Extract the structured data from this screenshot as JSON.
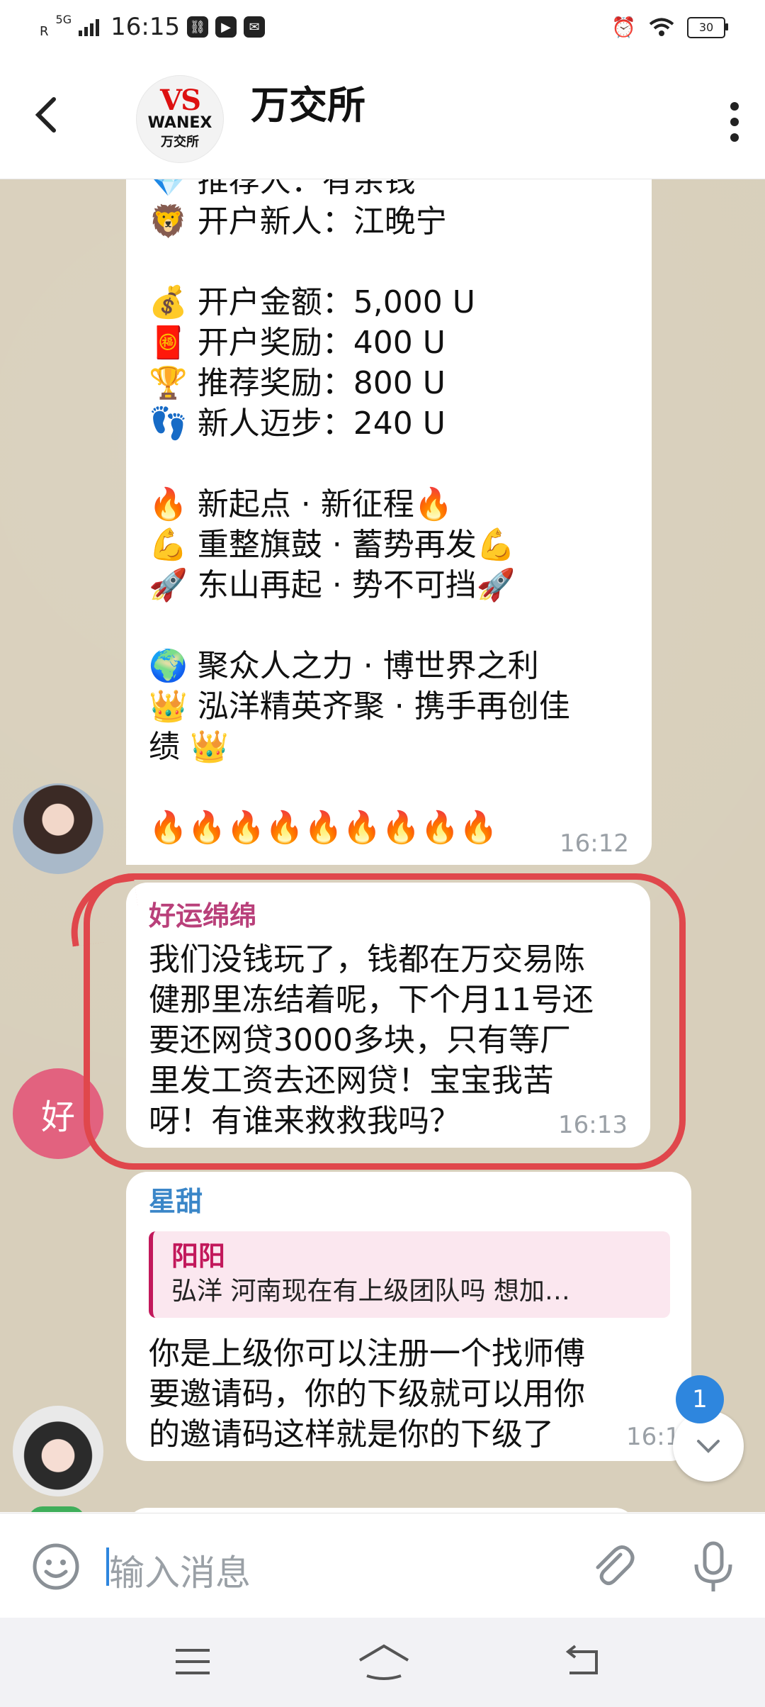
{
  "status_bar": {
    "network_label": "R",
    "network_type": "5G",
    "time": "16:15",
    "battery_level": "30"
  },
  "header": {
    "title": "万交所",
    "logo_mark": "VS",
    "logo_en": "WANEX",
    "logo_cn": "万交所"
  },
  "messages": [
    {
      "type": "announcement",
      "lines": [
        {
          "emoji": "💎",
          "text": "推荐人：有余钱"
        },
        {
          "emoji": "🦁",
          "text": "开户新人：江晚宁"
        },
        {
          "emoji": "",
          "text": ""
        },
        {
          "emoji": "💰",
          "text": "开户金额：5,000 U"
        },
        {
          "emoji": "🧧",
          "text": "开户奖励：400 U"
        },
        {
          "emoji": "🏆",
          "text": "推荐奖励：800 U"
        },
        {
          "emoji": "👣",
          "text": "新人迈步：240 U"
        },
        {
          "emoji": "",
          "text": ""
        },
        {
          "emoji": "🔥",
          "text": "新起点 · 新征程🔥"
        },
        {
          "emoji": "💪",
          "text": "重整旗鼓 · 蓄势再发💪"
        },
        {
          "emoji": "🚀",
          "text": "东山再起 · 势不可挡🚀"
        },
        {
          "emoji": "",
          "text": ""
        },
        {
          "emoji": "🌍",
          "text": "聚众人之力 · 博世界之利"
        },
        {
          "emoji": "👑",
          "text": "泓洋精英齐聚 · 携手再创佳"
        },
        {
          "emoji": "",
          "text": "绩 👑"
        },
        {
          "emoji": "",
          "text": ""
        },
        {
          "emoji": "",
          "text": "🔥🔥🔥🔥🔥🔥🔥🔥🔥"
        }
      ],
      "time": "16:12"
    },
    {
      "type": "text",
      "sender": "好运绵绵",
      "sender_color": "#b9407a",
      "avatar_letter": "好",
      "lines": [
        "我们没钱玩了，钱都在万交易陈",
        "健那里冻结着呢，下个月11号还",
        "要还网贷3000多块，只有等厂",
        "里发工资去还网贷！宝宝我苦",
        "呀！有谁来救救我吗？"
      ],
      "time": "16:13"
    },
    {
      "type": "reply",
      "sender": "星甜",
      "sender_color": "#3a86c8",
      "quote_name": "阳阳",
      "quote_text": "弘洋  河南现在有上级团队吗  想加…",
      "lines": [
        "你是上级你可以注册一个找师傅",
        "要邀请码，你的下级就可以用你",
        "的邀请码这样就是你的下级了"
      ],
      "time": "16:14"
    }
  ],
  "unread_count": "1",
  "input": {
    "placeholder": "输入消息"
  },
  "colors": {
    "chat_background": "#d8cfbb",
    "highlight_circle": "#e0474c",
    "accent_blue": "#2e86de",
    "avatar_pink": "#e2627f"
  }
}
